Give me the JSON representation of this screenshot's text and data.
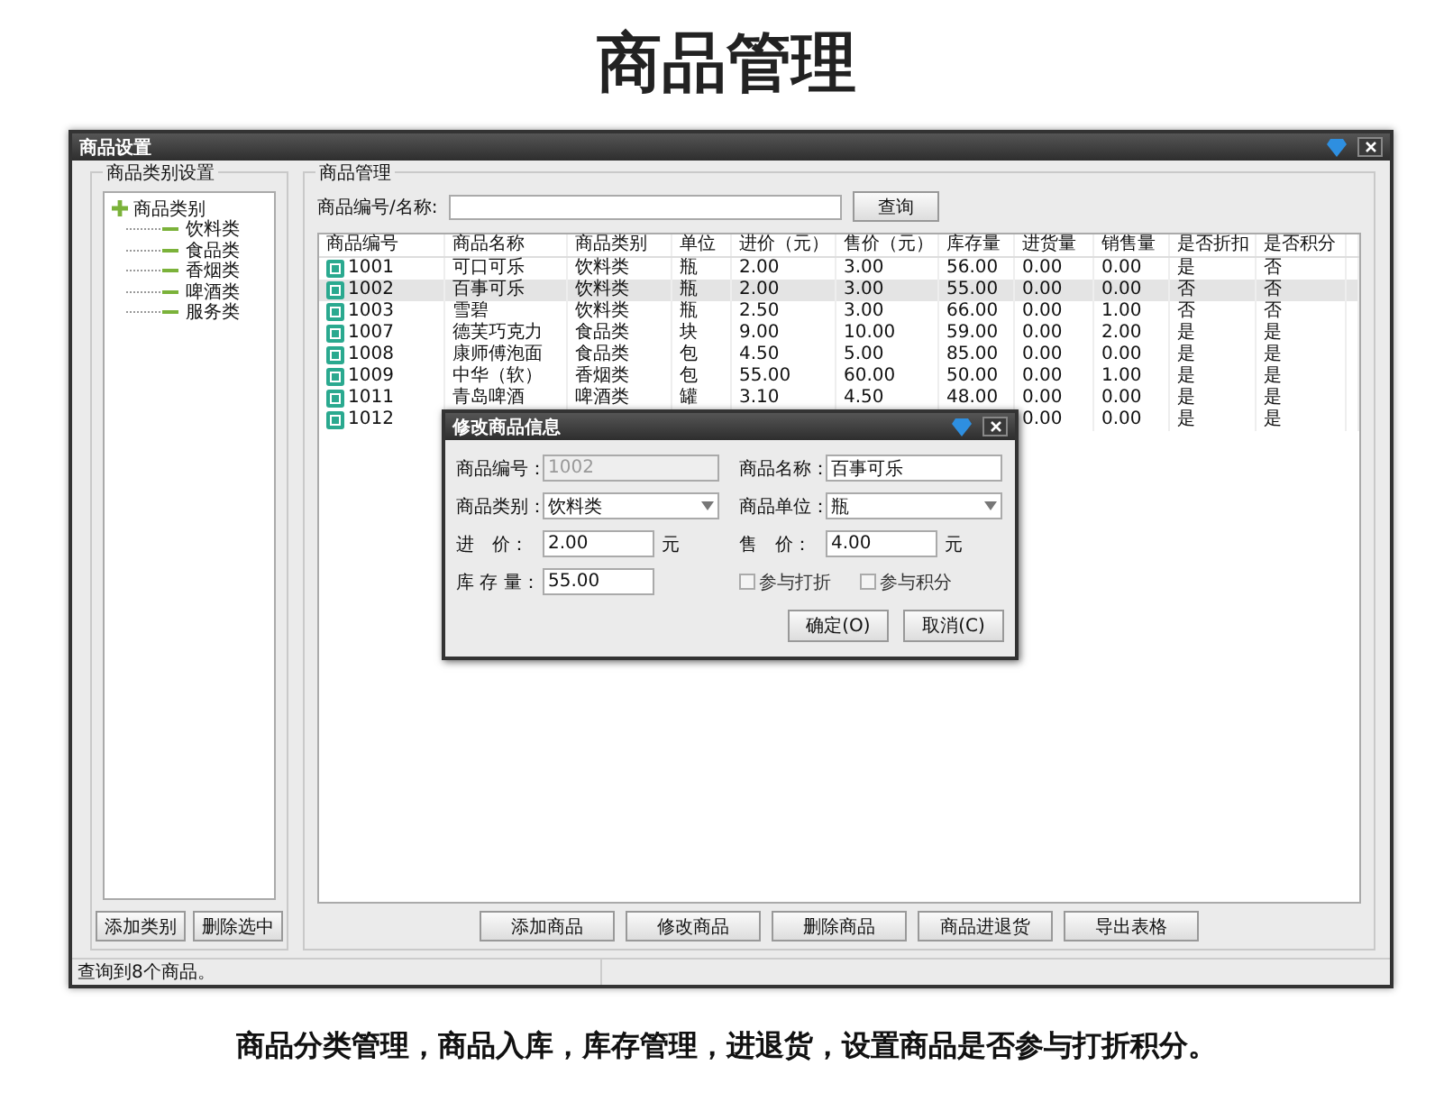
{
  "page_title": "商品管理",
  "window": {
    "title": "商品设置"
  },
  "category_panel": {
    "title": "商品类别设置",
    "tree": {
      "label": "商品类别",
      "children": [
        {
          "label": "饮料类"
        },
        {
          "label": "食品类"
        },
        {
          "label": "香烟类"
        },
        {
          "label": "啤酒类"
        },
        {
          "label": "服务类"
        }
      ]
    },
    "buttons": [
      "添加类别",
      "删除选中"
    ]
  },
  "product_panel": {
    "title": "商品管理",
    "search": {
      "label": "商品编号/名称:"
    },
    "search_button": "查询",
    "table": {
      "columns": [
        "商品编号",
        "商品名称",
        "商品类别",
        "单位",
        "进价（元）",
        "售价（元）",
        "库存量",
        "进货量",
        "销售量",
        "是否折扣",
        "是否积分"
      ],
      "rows": [
        {
          "selected": false,
          "cells": [
            "1001",
            "可口可乐",
            "饮料类",
            "瓶",
            "2.00",
            "3.00",
            "56.00",
            "0.00",
            "0.00",
            "是",
            "否"
          ]
        },
        {
          "selected": true,
          "cells": [
            "1002",
            "百事可乐",
            "饮料类",
            "瓶",
            "2.00",
            "3.00",
            "55.00",
            "0.00",
            "0.00",
            "否",
            "否"
          ]
        },
        {
          "selected": false,
          "cells": [
            "1003",
            "雪碧",
            "饮料类",
            "瓶",
            "2.50",
            "3.00",
            "66.00",
            "0.00",
            "1.00",
            "否",
            "否"
          ]
        },
        {
          "selected": false,
          "cells": [
            "1007",
            "德芙巧克力",
            "食品类",
            "块",
            "9.00",
            "10.00",
            "59.00",
            "0.00",
            "2.00",
            "是",
            "是"
          ]
        },
        {
          "selected": false,
          "cells": [
            "1008",
            "康师傅泡面",
            "食品类",
            "包",
            "4.50",
            "5.00",
            "85.00",
            "0.00",
            "0.00",
            "是",
            "是"
          ]
        },
        {
          "selected": false,
          "cells": [
            "1009",
            "中华（软）",
            "香烟类",
            "包",
            "55.00",
            "60.00",
            "50.00",
            "0.00",
            "1.00",
            "是",
            "是"
          ]
        },
        {
          "selected": false,
          "cells": [
            "1011",
            "青岛啤酒",
            "啤酒类",
            "罐",
            "3.10",
            "4.50",
            "48.00",
            "0.00",
            "0.00",
            "是",
            "是"
          ]
        },
        {
          "selected": false,
          "cells": [
            "1012",
            null,
            null,
            null,
            null,
            null,
            null,
            "0.00",
            "0.00",
            "是",
            "是"
          ]
        }
      ]
    },
    "buttons": [
      "添加商品",
      "修改商品",
      "删除商品",
      "商品进退货",
      "导出表格"
    ]
  },
  "status_bar": "查询到8个商品。",
  "dialog": {
    "title": "修改商品信息",
    "rows": [
      [
        {
          "kind": "text",
          "label": "商品编号：",
          "value": "1002",
          "disabled": true
        },
        {
          "kind": "text",
          "label": "商品名称：",
          "value": "百事可乐",
          "disabled": false
        }
      ],
      [
        {
          "kind": "select",
          "label": "商品类别：",
          "value": "饮料类"
        },
        {
          "kind": "select",
          "label": "商品单位：",
          "value": "瓶"
        }
      ],
      [
        {
          "kind": "text",
          "label": "进　价：",
          "value": "2.00",
          "disabled": false,
          "suffix": "元"
        },
        {
          "kind": "text",
          "label": "售　价：",
          "value": "4.00",
          "disabled": false,
          "suffix": "元"
        }
      ],
      [
        {
          "kind": "text",
          "label": "库 存 量：",
          "value": "55.00",
          "disabled": false
        },
        {
          "kind": "checks",
          "items": [
            {
              "label": "参与打折",
              "checked": false
            },
            {
              "label": "参与积分",
              "checked": false
            }
          ]
        }
      ]
    ],
    "buttons": [
      "确定(O)",
      "取消(C)"
    ]
  },
  "caption": "商品分类管理，商品入库，库存管理，进退货，设置商品是否参与打折积分。"
}
